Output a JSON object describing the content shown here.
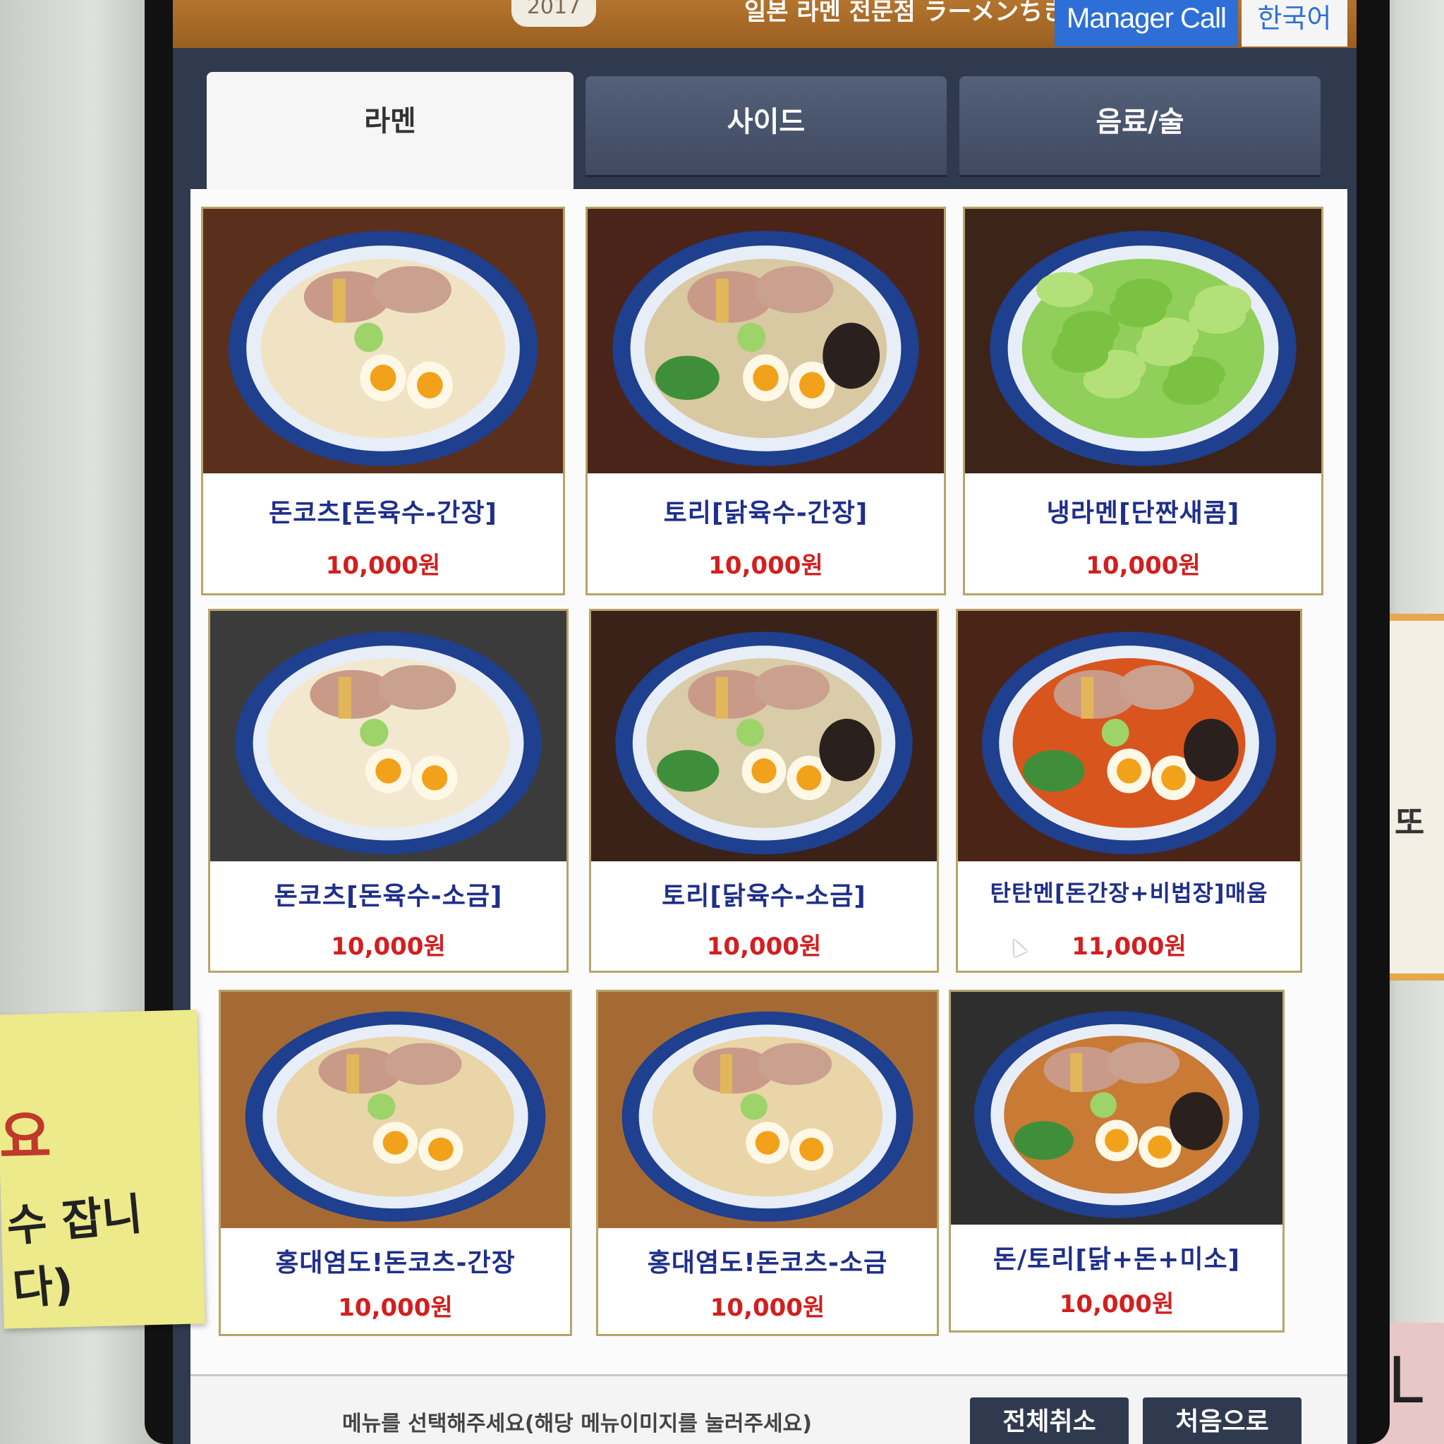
{
  "header": {
    "badge_text": "2017",
    "shop_name": "일본 라멘 전문점 ラーメンちきん",
    "manager_call": "Manager Call",
    "language": "한국어"
  },
  "tabs": [
    {
      "label": "라멘",
      "active": true
    },
    {
      "label": "사이드",
      "active": false
    },
    {
      "label": "음료/술",
      "active": false
    }
  ],
  "menu_items": [
    {
      "name": "돈코츠[돈육수-간장]",
      "price": "10,000원"
    },
    {
      "name": "토리[닭육수-간장]",
      "price": "10,000원"
    },
    {
      "name": "냉라멘[단짠새콤]",
      "price": "10,000원"
    },
    {
      "name": "돈코츠[돈육수-소금]",
      "price": "10,000원"
    },
    {
      "name": "토리[닭육수-소금]",
      "price": "10,000원"
    },
    {
      "name": "탄탄멘[돈간장+비법장]매움",
      "price": "11,000원"
    },
    {
      "name": "홍대염도!돈코츠-간장",
      "price": "10,000원"
    },
    {
      "name": "홍대염도!돈코츠-소금",
      "price": "10,000원"
    },
    {
      "name": "돈/토리[닭+돈+미소]",
      "price": "10,000원"
    }
  ],
  "footer": {
    "message": "메뉴를 선택해주세요(해당 메뉴이미지를 눌러주세요)",
    "cancel_all": "전체취소",
    "home": "처음으로"
  },
  "surroundings": {
    "sticky_note_a": "요",
    "sticky_note_b": "수 잡니다)",
    "right_card_text": "또",
    "right_pink_text": "L"
  },
  "colors": {
    "header_bg": "#a8692a",
    "manager_call_bg": "#2d6fd6",
    "tab_bg": "#46526a",
    "item_name": "#1f2f8a",
    "price": "#d21f1f"
  }
}
